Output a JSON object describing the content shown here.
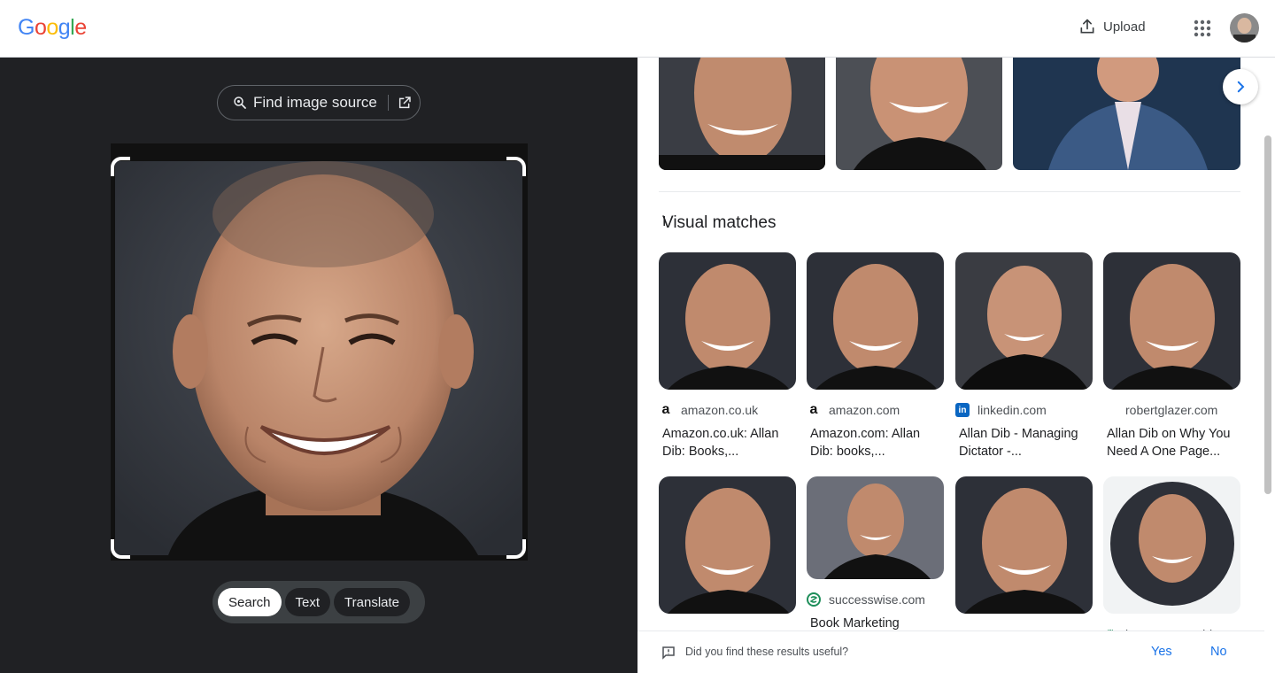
{
  "header": {
    "logo": "Google",
    "upload_label": "Upload"
  },
  "left_panel": {
    "find_source_label": "Find image source",
    "modes": [
      "Search",
      "Text",
      "Translate"
    ],
    "active_mode": "Search"
  },
  "results": {
    "section_title": "Visual matches",
    "cards": [
      {
        "source": "amazon.co.uk",
        "favicon": "amazon-icon",
        "title_line1": "Amazon.co.uk: Allan",
        "title_line2": "Dib: Books,..."
      },
      {
        "source": "amazon.com",
        "favicon": "amazon-icon",
        "title_line1": "Amazon.com: Allan",
        "title_line2": "Dib: books,..."
      },
      {
        "source": "linkedin.com",
        "favicon": "linkedin-icon",
        "title_line1": "Allan Dib - Managing",
        "title_line2": "Dictator -..."
      },
      {
        "source": "robertglazer.com",
        "favicon": "",
        "title_line1": "Allan Dib on Why You",
        "title_line2": "Need A One Page..."
      }
    ],
    "row2": [
      {
        "source": "successwise.com",
        "title": "Book Marketing"
      },
      {
        "source": "karewarecoachin"
      }
    ]
  },
  "feedback": {
    "question": "Did you find these results useful?",
    "yes": "Yes",
    "no": "No"
  },
  "colors": {
    "accent": "#1a73e8",
    "dark_panel": "#202124"
  }
}
